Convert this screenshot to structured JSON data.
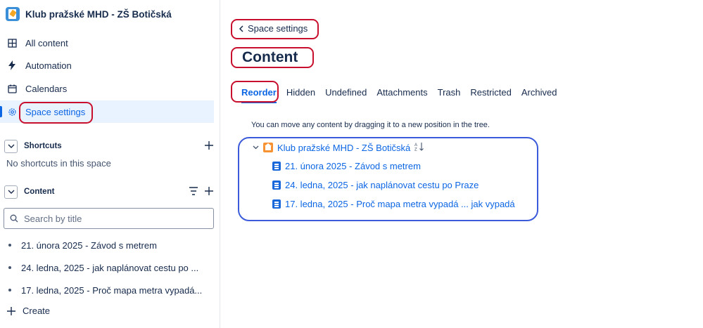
{
  "sidebar": {
    "space_title": "Klub pražské MHD - ZŠ Botičská",
    "nav": [
      {
        "label": "All content",
        "icon": "grid-icon"
      },
      {
        "label": "Automation",
        "icon": "lightning-icon"
      },
      {
        "label": "Calendars",
        "icon": "calendar-icon"
      },
      {
        "label": "Space settings",
        "icon": "gear-icon",
        "selected": true
      }
    ],
    "shortcuts": {
      "title": "Shortcuts",
      "empty": "No shortcuts in this space"
    },
    "content": {
      "title": "Content",
      "search_placeholder": "Search by title",
      "items": [
        "21. února 2025 - Závod s metrem",
        "24. ledna, 2025 - jak naplánovat cestu po ...",
        "17. ledna, 2025 - Proč mapa metra vypadá..."
      ]
    },
    "create_label": "Create"
  },
  "main": {
    "back_label": "Space settings",
    "title": "Content",
    "tabs": [
      "Reorder",
      "Hidden",
      "Undefined",
      "Attachments",
      "Trash",
      "Restricted",
      "Archived"
    ],
    "active_tab": "Reorder",
    "hint": "You can move any content by dragging it to a new position in the tree.",
    "tree": {
      "root": "Klub pražské MHD - ZŠ Botičská",
      "children": [
        "21. února 2025 - Závod s metrem",
        "24. ledna, 2025 - jak naplánovat cestu po Praze",
        "17. ledna, 2025 - Proč mapa metra vypadá ... jak vypadá"
      ]
    }
  },
  "colors": {
    "accent": "#0c66e4",
    "annotation_red": "#c8102e",
    "annotation_blue": "#3b5bdb",
    "selected_bg": "#e9f2ff"
  }
}
